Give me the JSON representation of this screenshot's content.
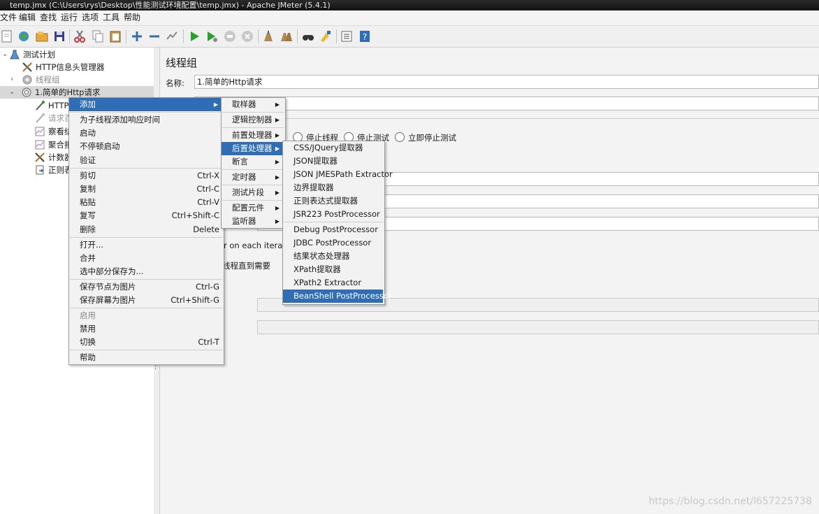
{
  "window": {
    "title": "temp.jmx (C:\\Users\\rys\\Desktop\\性能测试环境配置\\temp.jmx) - Apache JMeter (5.4.1)"
  },
  "menubar": [
    "文件",
    "编辑",
    "查找",
    "运行",
    "选项",
    "工具",
    "帮助"
  ],
  "tree": {
    "items": [
      {
        "label": "测试计划",
        "icon": "test-plan-icon"
      },
      {
        "label": "HTTP信息头管理器",
        "icon": "header-manager-icon"
      },
      {
        "label": "线程组",
        "icon": "thread-group-icon"
      },
      {
        "label": "1.简单的Http请求",
        "icon": "thread-group-icon"
      },
      {
        "label": "HTTPi",
        "icon": "sampler-pipette-icon"
      },
      {
        "label": "请求百",
        "icon": "sampler-pipette-icon"
      },
      {
        "label": "察看结",
        "icon": "listener-chart-icon"
      },
      {
        "label": "聚合报",
        "icon": "listener-chart-icon"
      },
      {
        "label": "计数器",
        "icon": "counter-tools-icon"
      },
      {
        "label": "正则表",
        "icon": "regex-extractor-icon"
      }
    ]
  },
  "panel": {
    "title": "线程组",
    "name_label": "名称:",
    "name_value": "1.简单的Http请求",
    "radio_stop_thread": "停止线程",
    "radio_stop_test": "停止测试",
    "radio_stop_test_now": "立即停止测试",
    "same_user_text": "r on each iteration",
    "delay_text": "线程直到需要"
  },
  "context_menu": {
    "items": [
      {
        "label": "添加",
        "shortcut": "",
        "submenu": true,
        "highlight": true
      },
      {
        "label": "为子线程添加响应时间",
        "shortcut": ""
      },
      {
        "label": "启动",
        "shortcut": ""
      },
      {
        "label": "不停顿启动",
        "shortcut": ""
      },
      {
        "label": "验证",
        "shortcut": ""
      },
      {
        "label": "剪切",
        "shortcut": "Ctrl-X"
      },
      {
        "label": "复制",
        "shortcut": "Ctrl-C"
      },
      {
        "label": "粘贴",
        "shortcut": "Ctrl-V"
      },
      {
        "label": "复写",
        "shortcut": "Ctrl+Shift-C"
      },
      {
        "label": "删除",
        "shortcut": "Delete"
      },
      {
        "label": "打开...",
        "shortcut": ""
      },
      {
        "label": "合并",
        "shortcut": ""
      },
      {
        "label": "选中部分保存为...",
        "shortcut": ""
      },
      {
        "label": "保存节点为图片",
        "shortcut": "Ctrl-G"
      },
      {
        "label": "保存屏幕为图片",
        "shortcut": "Ctrl+Shift-G"
      },
      {
        "label": "启用",
        "shortcut": "",
        "disabled": true
      },
      {
        "label": "禁用",
        "shortcut": ""
      },
      {
        "label": "切换",
        "shortcut": "Ctrl-T"
      },
      {
        "label": "帮助",
        "shortcut": ""
      }
    ]
  },
  "add_submenu": {
    "items": [
      {
        "label": "取样器",
        "submenu": true
      },
      {
        "label": "逻辑控制器",
        "submenu": true
      },
      {
        "label": "前置处理器",
        "submenu": true
      },
      {
        "label": "后置处理器",
        "submenu": true,
        "highlight": true
      },
      {
        "label": "断言",
        "submenu": true
      },
      {
        "label": "定时器",
        "submenu": true
      },
      {
        "label": "测试片段",
        "submenu": true
      },
      {
        "label": "配置元件",
        "submenu": true
      },
      {
        "label": "监听器",
        "submenu": true
      }
    ]
  },
  "postprocessor_submenu": {
    "items": [
      {
        "label": "CSS/JQuery提取器"
      },
      {
        "label": "JSON提取器"
      },
      {
        "label": "JSON JMESPath Extractor"
      },
      {
        "label": "边界提取器"
      },
      {
        "label": "正则表达式提取器"
      },
      {
        "label": "JSR223 PostProcessor"
      },
      {
        "label": "Debug PostProcessor"
      },
      {
        "label": "JDBC PostProcessor"
      },
      {
        "label": "结果状态处理器"
      },
      {
        "label": "XPath提取器"
      },
      {
        "label": "XPath2 Extractor"
      },
      {
        "label": "BeanShell PostProcessor",
        "highlight": true
      }
    ]
  },
  "watermark": "https://blog.csdn.net/l657225738",
  "colors": {
    "highlight": "#2f6db5",
    "menu_bg": "#f2f2f2",
    "title_bar": "#1a1a1a"
  }
}
